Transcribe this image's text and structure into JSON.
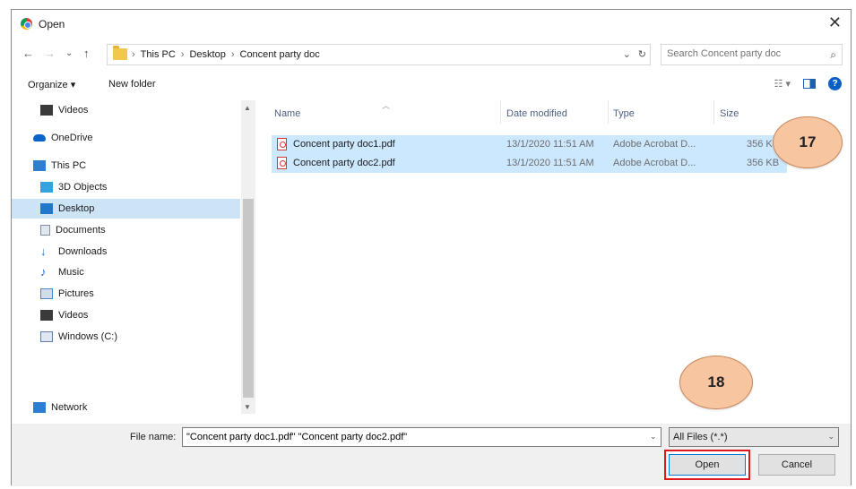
{
  "window": {
    "title": "Open",
    "close_glyph": "✕"
  },
  "nav": {
    "back_glyph": "←",
    "forward_glyph": "→",
    "recent_glyph": "⌄",
    "up_glyph": "↑",
    "breadcrumbs": [
      "This PC",
      "Desktop",
      "Concent party doc"
    ],
    "sep": "›",
    "addr_dropdown": "⌄",
    "refresh_glyph": "↻",
    "search_placeholder": "Search Concent party doc",
    "search_glyph": "⌕"
  },
  "toolbar": {
    "organize_label": "Organize ▾",
    "new_folder_label": "New folder",
    "view_label": "☷ ▾",
    "help_glyph": "?"
  },
  "sidebar": {
    "items": [
      {
        "label": "Videos",
        "icon": "video-icon",
        "color": "#3a3a3a"
      },
      {
        "label": "OneDrive",
        "icon": "cloud-icon",
        "color": "#0a64c8"
      },
      {
        "label": "This PC",
        "icon": "pc-icon",
        "color": "#2f7fd1"
      },
      {
        "label": "3D Objects",
        "icon": "cube-icon",
        "color": "#35a3e0"
      },
      {
        "label": "Desktop",
        "icon": "desktop-icon",
        "color": "#2177c9",
        "selected": true
      },
      {
        "label": "Documents",
        "icon": "document-icon",
        "color": "#7f8fa6"
      },
      {
        "label": "Downloads",
        "icon": "download-icon",
        "color": "#1e6fcf"
      },
      {
        "label": "Music",
        "icon": "music-icon",
        "color": "#1e6fcf"
      },
      {
        "label": "Pictures",
        "icon": "picture-icon",
        "color": "#4a88c7"
      },
      {
        "label": "Videos",
        "icon": "video-icon",
        "color": "#3a3a3a"
      },
      {
        "label": "Windows (C:)",
        "icon": "drive-icon",
        "color": "#5f7fa6"
      },
      {
        "label": "Network",
        "icon": "network-icon",
        "color": "#2a7fd4"
      }
    ]
  },
  "files": {
    "columns": [
      "Name",
      "Date modified",
      "Type",
      "Size"
    ],
    "rows": [
      {
        "name": "Concent party doc1.pdf",
        "date": "13/1/2020 11:51 AM",
        "type": "Adobe Acrobat D...",
        "size": "356 KB"
      },
      {
        "name": "Concent party doc2.pdf",
        "date": "13/1/2020 11:51 AM",
        "type": "Adobe Acrobat D...",
        "size": "356 KB"
      }
    ]
  },
  "callouts": {
    "first": "17",
    "second": "18"
  },
  "footer": {
    "file_name_label": "File name:",
    "file_name_value": "\"Concent party doc1.pdf\" \"Concent party doc2.pdf\"",
    "filter_value": "All Files (*.*)",
    "open_label": "Open",
    "cancel_label": "Cancel"
  }
}
